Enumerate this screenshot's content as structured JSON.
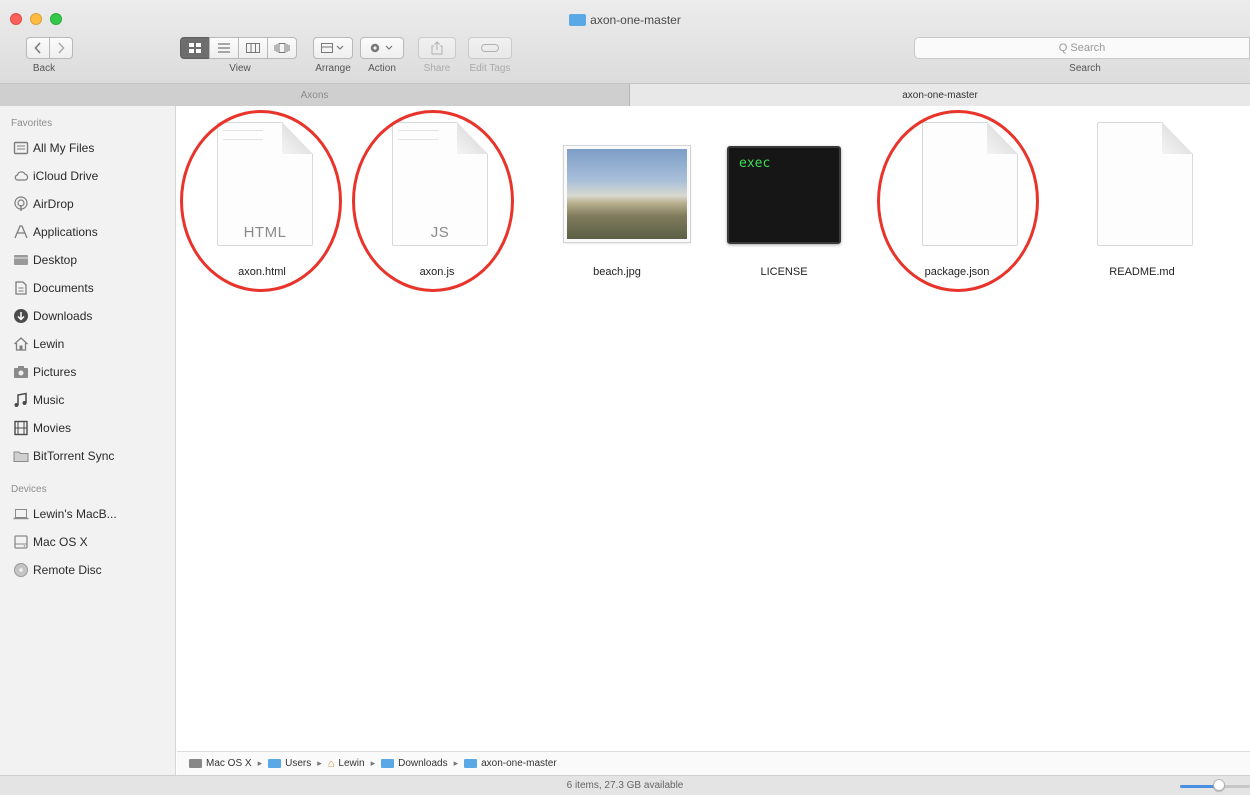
{
  "window": {
    "title": "axon-one-master"
  },
  "toolbar": {
    "back_label": "Back",
    "view_label": "View",
    "arrange_label": "Arrange",
    "action_label": "Action",
    "share_label": "Share",
    "edit_tags_label": "Edit Tags",
    "search_label": "Search",
    "search_placeholder": "Q Search"
  },
  "tabs": [
    {
      "label": "Axons",
      "active": false
    },
    {
      "label": "axon-one-master",
      "active": true
    }
  ],
  "sidebar": {
    "favorites_title": "Favorites",
    "favorites": [
      {
        "label": "All My Files",
        "icon": "all-files-icon"
      },
      {
        "label": "iCloud Drive",
        "icon": "cloud-icon"
      },
      {
        "label": "AirDrop",
        "icon": "airdrop-icon"
      },
      {
        "label": "Applications",
        "icon": "applications-icon"
      },
      {
        "label": "Desktop",
        "icon": "desktop-icon"
      },
      {
        "label": "Documents",
        "icon": "documents-icon"
      },
      {
        "label": "Downloads",
        "icon": "downloads-icon"
      },
      {
        "label": "Lewin",
        "icon": "home-icon"
      },
      {
        "label": "Pictures",
        "icon": "pictures-icon"
      },
      {
        "label": "Music",
        "icon": "music-icon"
      },
      {
        "label": "Movies",
        "icon": "movies-icon"
      },
      {
        "label": "BitTorrent Sync",
        "icon": "folder-icon"
      }
    ],
    "devices_title": "Devices",
    "devices": [
      {
        "label": "Lewin's MacB...",
        "icon": "laptop-icon"
      },
      {
        "label": "Mac OS X",
        "icon": "disk-icon"
      },
      {
        "label": "Remote Disc",
        "icon": "remote-disc-icon"
      }
    ]
  },
  "files": [
    {
      "name": "axon.html",
      "kind": "document",
      "badge": "HTML",
      "highlighted": true
    },
    {
      "name": "axon.js",
      "kind": "document",
      "badge": "JS",
      "highlighted": true
    },
    {
      "name": "beach.jpg",
      "kind": "photo",
      "badge": "",
      "highlighted": false
    },
    {
      "name": "LICENSE",
      "kind": "terminal",
      "badge": "exec",
      "highlighted": false
    },
    {
      "name": "package.json",
      "kind": "document",
      "badge": "",
      "highlighted": true
    },
    {
      "name": "README.md",
      "kind": "document",
      "badge": "",
      "highlighted": false
    }
  ],
  "pathbar": [
    {
      "label": "Mac OS X",
      "icon": "disk-icon"
    },
    {
      "label": "Users",
      "icon": "folder-icon"
    },
    {
      "label": "Lewin",
      "icon": "home-icon"
    },
    {
      "label": "Downloads",
      "icon": "folder-icon"
    },
    {
      "label": "axon-one-master",
      "icon": "folder-icon"
    }
  ],
  "status": {
    "text": "6 items, 27.3 GB available",
    "icon_size_level": 0.55
  },
  "colors": {
    "highlight_ring": "#e8342a",
    "terminal_text": "#3ddc55",
    "folder_blue": "#5aa9e6"
  }
}
